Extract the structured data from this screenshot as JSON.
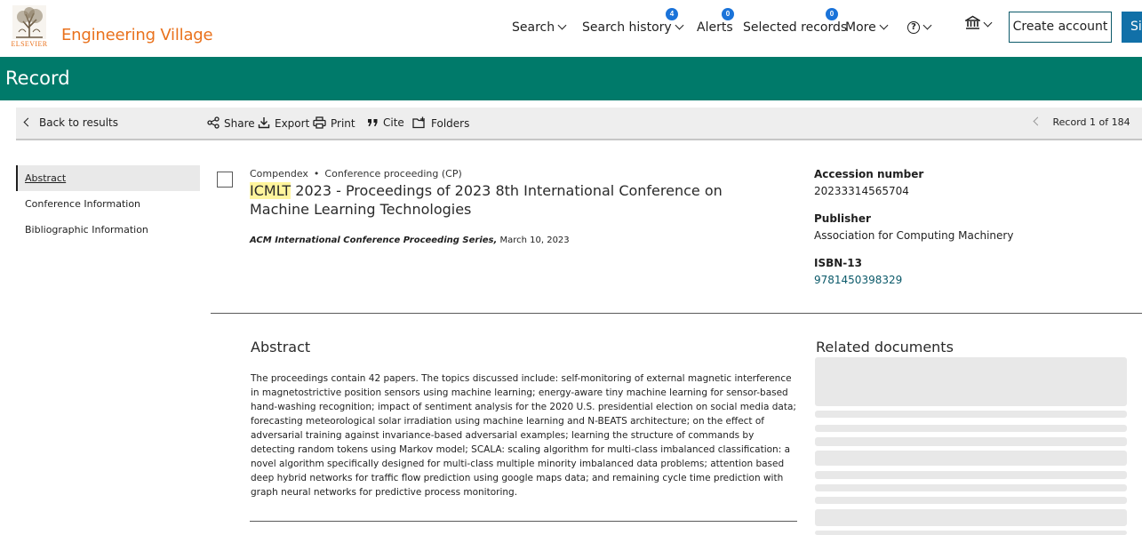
{
  "brand": {
    "logo_word": "ELSEVIER",
    "name": "Engineering Village"
  },
  "nav": {
    "search": "Search",
    "search_history": "Search history",
    "search_history_count": "4",
    "alerts": "Alerts",
    "alerts_count": "0",
    "selected_records": "Selected records",
    "selected_records_count": "0",
    "more": "More",
    "help_icon": "question-circle-icon",
    "institution_icon": "institution-icon",
    "create_account": "Create account",
    "sign_in": "Si"
  },
  "banner": {
    "title": "Record"
  },
  "toolbar": {
    "back": "Back to results",
    "share": "Share",
    "export": "Export",
    "print": "Print",
    "cite": "Cite",
    "folders": "Folders",
    "record_position": "Record 1 of 184"
  },
  "sidebar": {
    "items": [
      {
        "label": "Abstract"
      },
      {
        "label": "Conference Information"
      },
      {
        "label": "Bibliographic Information"
      }
    ]
  },
  "record": {
    "database": "Compendex",
    "doc_type": "Conference proceeding (CP)",
    "title_highlight": "ICMLT",
    "title_rest": " 2023 - Proceedings of 2023 8th International Conference on Machine Learning Technologies",
    "series": "ACM International Conference Proceeding Series,",
    "date": " March 10, 2023",
    "accession_label": "Accession number",
    "accession_value": "20233314565704",
    "publisher_label": "Publisher",
    "publisher_value": "Association for Computing Machinery",
    "isbn_label": "ISBN-13",
    "isbn_value": "9781450398329"
  },
  "abstract": {
    "heading": "Abstract",
    "text": "The proceedings contain 42 papers. The topics discussed include: self-monitoring of external magnetic interference in magnetostrictive position sensors using machine learning; energy-aware tiny machine learning for sensor-based hand-washing recognition; impact of sentiment analysis for the 2020 U.S. presidential election on social media data; forecasting meteorological solar irradiation using machine learning and N-BEATS architecture; on the effect of adversarial training against invariance-based adversarial examples; learning the structure of commands by detecting random tokens using Markov model; SCALA: scaling algorithm for multi-class imbalanced classification: a novel algorithm specifically designed for multi-class multiple minority imbalanced data problems; attention based deep hybrid networks for traffic flow prediction using google maps data; and remaining cycle time prediction with graph neural networks for predictive process monitoring."
  },
  "related": {
    "heading": "Related documents"
  },
  "colors": {
    "brand_orange": "#e9711c",
    "banner_teal": "#007a6a",
    "badge_blue": "#1a73d9",
    "link_teal": "#0c5a6a",
    "signin_blue": "#1170a8",
    "highlight": "#fff59d"
  }
}
